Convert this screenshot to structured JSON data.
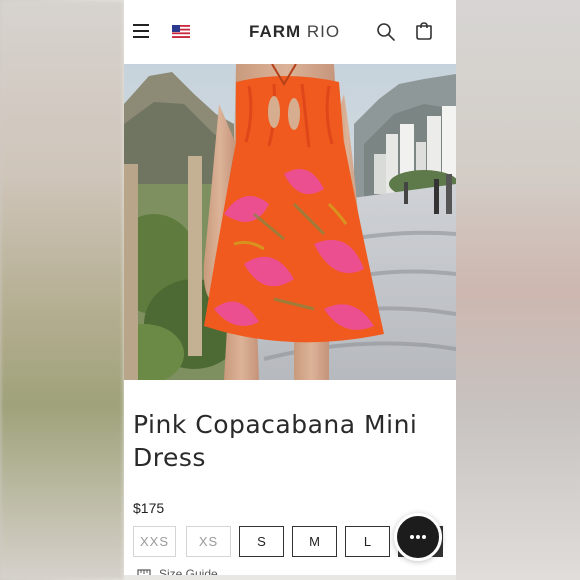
{
  "header": {
    "logo_main": "FARM",
    "logo_sub": "RIO",
    "menu_icon": "hamburger-icon",
    "flag_icon": "us-flag-icon",
    "search_icon": "search-icon",
    "cart_icon": "shopping-bag-icon"
  },
  "product": {
    "title": "Pink Copacabana Mini Dress",
    "price": "$175",
    "image": "hero-product-photo"
  },
  "sizes": [
    "XXS",
    "XS",
    "S",
    "M",
    "L",
    "XL"
  ],
  "size_guide": {
    "label": "Size Guide",
    "icon": "ruler-icon"
  },
  "chat": {
    "icon": "chat-bubble-icon"
  },
  "colors": {
    "dress_orange": "#f05a1e",
    "dress_pink": "#ec4f8f",
    "text_dark": "#2a2a2a",
    "button_dark": "#333333"
  }
}
